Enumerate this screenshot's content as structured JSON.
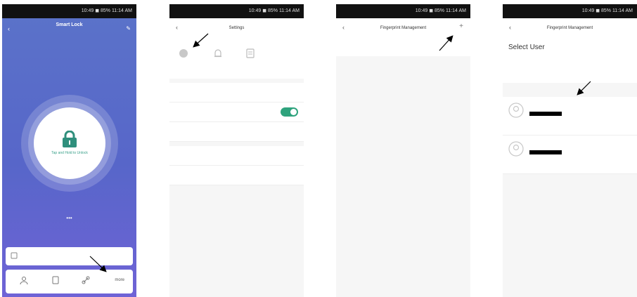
{
  "status_bar": {
    "text": "10:49 ◼ 85% 11:14 AM"
  },
  "screen1": {
    "title": "Smart Lock",
    "subtitle": "",
    "online_label": "",
    "unlock_text": "Tap and Hold to Unlock",
    "dots": "•••",
    "message_text": "",
    "more_label": "more"
  },
  "screen2": {
    "title": "Settings",
    "items": [
      {
        "label": "",
        "value": ""
      },
      {
        "label": "",
        "value": ""
      },
      {
        "label": "",
        "value": ""
      },
      {
        "label": "",
        "value": ""
      },
      {
        "label": "",
        "value": ""
      }
    ]
  },
  "screen3": {
    "title": "Fingerprint Management"
  },
  "screen4": {
    "title": "Fingerprint Management",
    "heading": "Select User",
    "users": [
      {
        "name": ""
      },
      {
        "name": ""
      }
    ]
  },
  "colors": {
    "accent_green": "#2fa37d",
    "lock_blue": "#5766c9"
  },
  "icons": [
    "back-arrow-icon",
    "lock-icon",
    "add-icon",
    "avatar-icon",
    "gear-icon",
    "bell-icon",
    "doc-icon"
  ]
}
